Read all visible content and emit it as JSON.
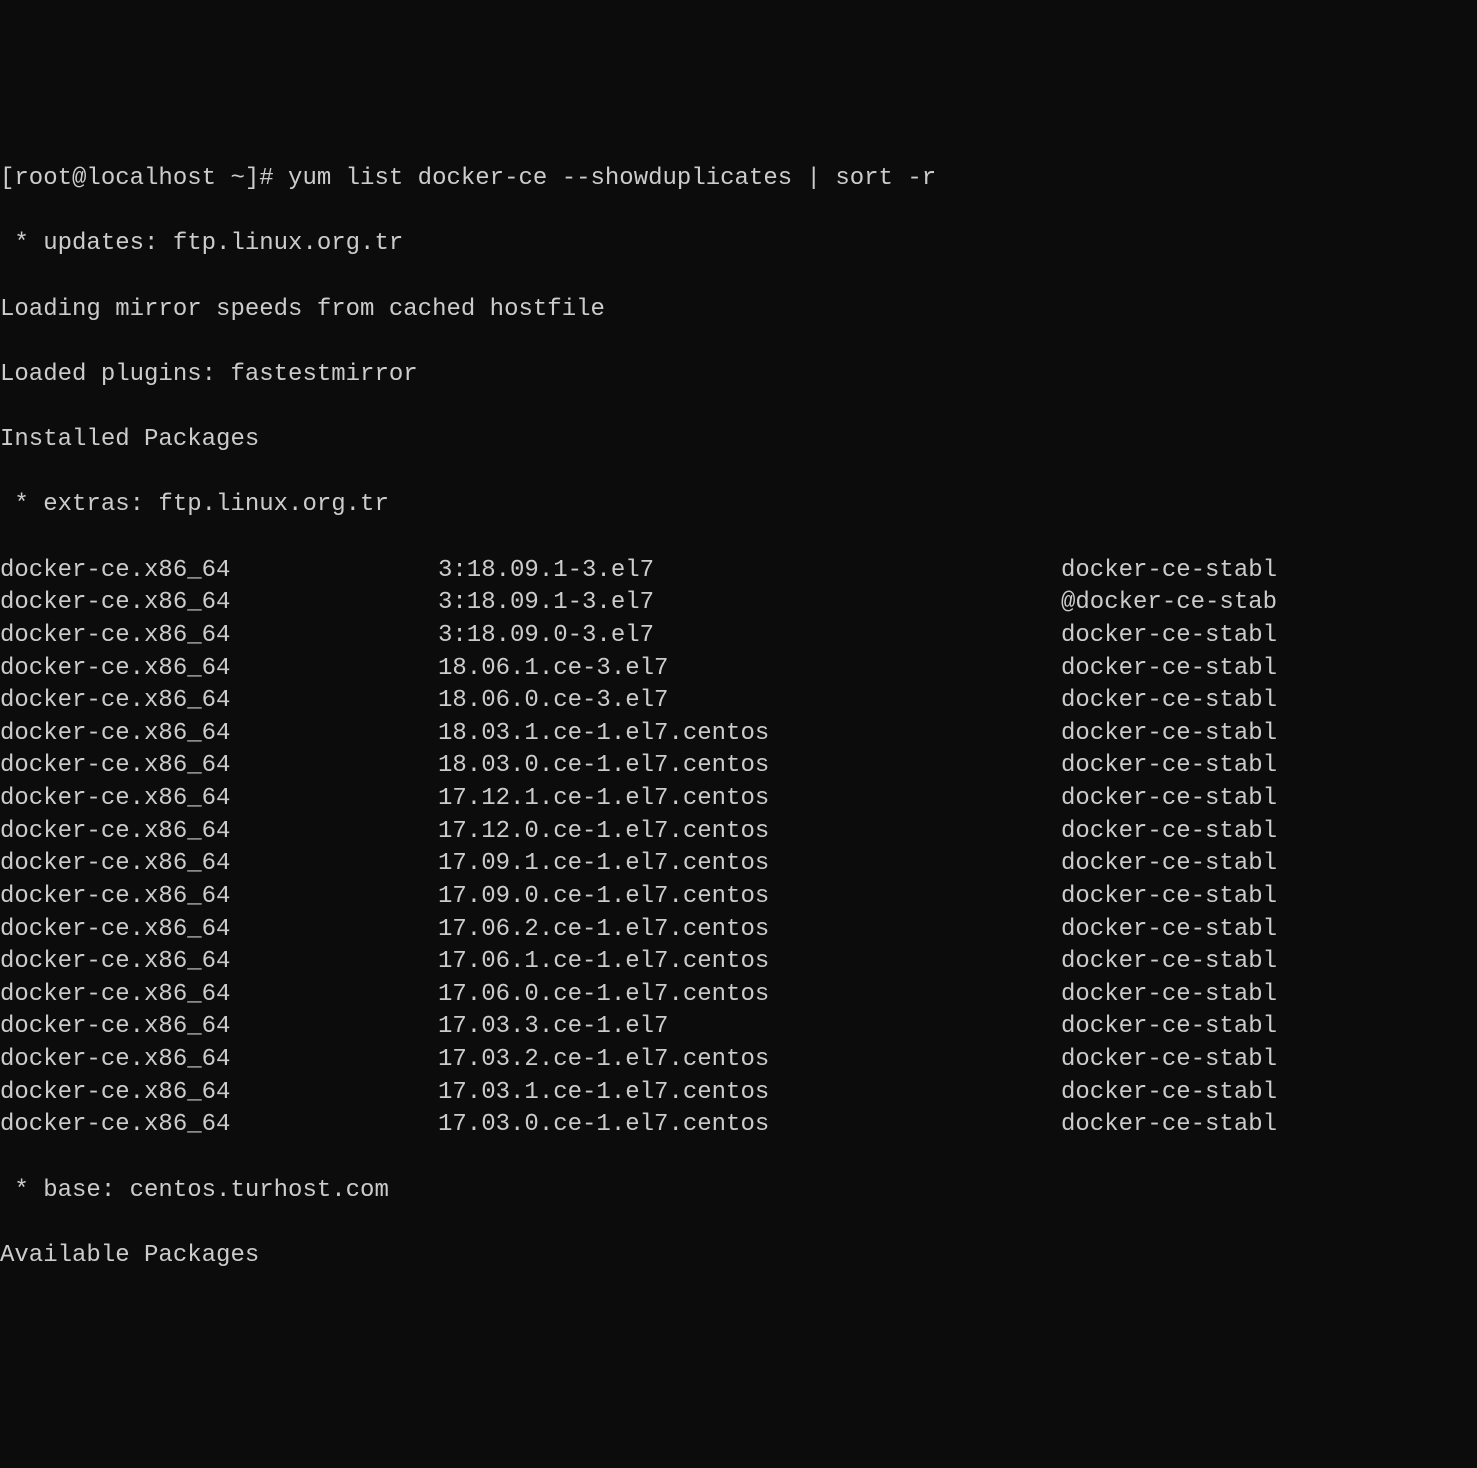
{
  "prompt": "[root@localhost ~]# yum list docker-ce --showduplicates | sort -r",
  "headers": {
    "updates": " * updates: ftp.linux.org.tr",
    "loading": "Loading mirror speeds from cached hostfile",
    "loaded": "Loaded plugins: fastestmirror",
    "installed": "Installed Packages",
    "extras": " * extras: ftp.linux.org.tr",
    "base": " * base: centos.turhost.com",
    "available": "Available Packages"
  },
  "packages": [
    {
      "name": "docker-ce.x86_64",
      "version": "3:18.09.1-3.el7",
      "repo": "docker-ce-stabl"
    },
    {
      "name": "docker-ce.x86_64",
      "version": "3:18.09.1-3.el7",
      "repo": "@docker-ce-stab"
    },
    {
      "name": "docker-ce.x86_64",
      "version": "3:18.09.0-3.el7",
      "repo": "docker-ce-stabl"
    },
    {
      "name": "docker-ce.x86_64",
      "version": "18.06.1.ce-3.el7",
      "repo": "docker-ce-stabl"
    },
    {
      "name": "docker-ce.x86_64",
      "version": "18.06.0.ce-3.el7",
      "repo": "docker-ce-stabl"
    },
    {
      "name": "docker-ce.x86_64",
      "version": "18.03.1.ce-1.el7.centos",
      "repo": "docker-ce-stabl"
    },
    {
      "name": "docker-ce.x86_64",
      "version": "18.03.0.ce-1.el7.centos",
      "repo": "docker-ce-stabl"
    },
    {
      "name": "docker-ce.x86_64",
      "version": "17.12.1.ce-1.el7.centos",
      "repo": "docker-ce-stabl"
    },
    {
      "name": "docker-ce.x86_64",
      "version": "17.12.0.ce-1.el7.centos",
      "repo": "docker-ce-stabl"
    },
    {
      "name": "docker-ce.x86_64",
      "version": "17.09.1.ce-1.el7.centos",
      "repo": "docker-ce-stabl"
    },
    {
      "name": "docker-ce.x86_64",
      "version": "17.09.0.ce-1.el7.centos",
      "repo": "docker-ce-stabl"
    },
    {
      "name": "docker-ce.x86_64",
      "version": "17.06.2.ce-1.el7.centos",
      "repo": "docker-ce-stabl"
    },
    {
      "name": "docker-ce.x86_64",
      "version": "17.06.1.ce-1.el7.centos",
      "repo": "docker-ce-stabl"
    },
    {
      "name": "docker-ce.x86_64",
      "version": "17.06.0.ce-1.el7.centos",
      "repo": "docker-ce-stabl"
    },
    {
      "name": "docker-ce.x86_64",
      "version": "17.03.3.ce-1.el7",
      "repo": "docker-ce-stabl"
    },
    {
      "name": "docker-ce.x86_64",
      "version": "17.03.2.ce-1.el7.centos",
      "repo": "docker-ce-stabl"
    },
    {
      "name": "docker-ce.x86_64",
      "version": "17.03.1.ce-1.el7.centos",
      "repo": "docker-ce-stabl"
    },
    {
      "name": "docker-ce.x86_64",
      "version": "17.03.0.ce-1.el7.centos",
      "repo": "docker-ce-stabl"
    }
  ]
}
